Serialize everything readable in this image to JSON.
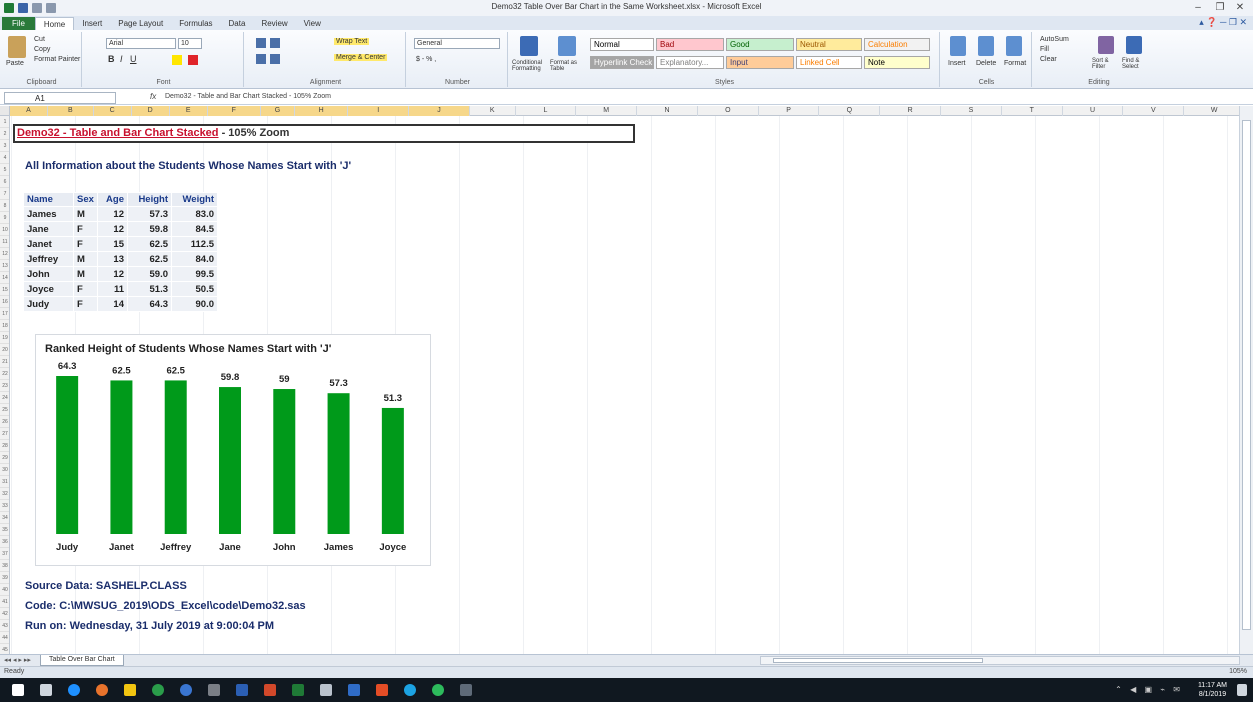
{
  "window": {
    "title": "Demo32 Table Over Bar Chart in the Same Worksheet.xlsx - Microsoft Excel",
    "minimize": "–",
    "restore": "❐",
    "close": "✕",
    "help_icons": "▴ ❓ ─ ❐ ✕"
  },
  "ribbon": {
    "tabs": [
      {
        "label": "File"
      },
      {
        "label": "Home"
      },
      {
        "label": "Insert"
      },
      {
        "label": "Page Layout"
      },
      {
        "label": "Formulas"
      },
      {
        "label": "Data"
      },
      {
        "label": "Review"
      },
      {
        "label": "View"
      }
    ],
    "clipboard": {
      "cut": "Cut",
      "copy": "Copy",
      "paste": "Paste",
      "format_painter": "Format Painter",
      "group_label": "Clipboard"
    },
    "font": {
      "font_name": "Arial",
      "font_size": "10",
      "group_label": "Font"
    },
    "alignment": {
      "wrap_text": "Wrap Text",
      "merge_center": "Merge & Center",
      "group_label": "Alignment"
    },
    "number": {
      "format": "General",
      "group_label": "Number"
    },
    "styles": {
      "conditional_formatting": "Conditional Formatting",
      "format_as_table": "Format as Table",
      "cell_styles": [
        {
          "label": "Normal",
          "bg": "#ffffff",
          "color": "#000000"
        },
        {
          "label": "Bad",
          "bg": "#ffc7ce",
          "color": "#9c0006"
        },
        {
          "label": "Good",
          "bg": "#c6efce",
          "color": "#006100"
        },
        {
          "label": "Neutral",
          "bg": "#ffeb9c",
          "color": "#9c5700"
        },
        {
          "label": "Calculation",
          "bg": "#f2f2f2",
          "color": "#fa7d00"
        },
        {
          "label": "Hyperlink Check Cell",
          "bg": "#a5a5a5",
          "color": "#ffffff"
        },
        {
          "label": "Explanatory...",
          "bg": "#ffffff",
          "color": "#7f7f7f"
        },
        {
          "label": "Input",
          "bg": "#ffcc99",
          "color": "#3f3f76"
        },
        {
          "label": "Linked Cell",
          "bg": "#ffffff",
          "color": "#fa7d00"
        },
        {
          "label": "Note",
          "bg": "#ffffcc",
          "color": "#000000"
        }
      ],
      "group_label": "Styles"
    },
    "cells": {
      "insert": "Insert",
      "delete": "Delete",
      "format": "Format",
      "group_label": "Cells"
    },
    "editing": {
      "autosum": "AutoSum",
      "fill": "Fill",
      "clear": "Clear",
      "sort_filter": "Sort & Filter",
      "find_select": "Find & Select",
      "group_label": "Editing"
    }
  },
  "formula_bar": {
    "name_box": "A1",
    "fx": "fx",
    "content": "Demo32 - Table and Bar Chart Stacked - 105% Zoom"
  },
  "columns": [
    "A",
    "B",
    "C",
    "D",
    "E",
    "F",
    "G",
    "H",
    "I",
    "J",
    "K",
    "L",
    "M",
    "N",
    "O",
    "P",
    "Q",
    "R",
    "S",
    "T",
    "U",
    "V",
    "W"
  ],
  "sheet": {
    "title_red": "Demo32 - Table and Bar Chart Stacked",
    "title_black": " - 105% Zoom",
    "subtitle": "All Information about the Students Whose Names Start with 'J'",
    "table": {
      "headers": [
        "Name",
        "Sex",
        "Age",
        "Height",
        "Weight"
      ],
      "rows": [
        [
          "James",
          "M",
          "12",
          "57.3",
          "83.0"
        ],
        [
          "Jane",
          "F",
          "12",
          "59.8",
          "84.5"
        ],
        [
          "Janet",
          "F",
          "15",
          "62.5",
          "112.5"
        ],
        [
          "Jeffrey",
          "M",
          "13",
          "62.5",
          "84.0"
        ],
        [
          "John",
          "M",
          "12",
          "59.0",
          "99.5"
        ],
        [
          "Joyce",
          "F",
          "11",
          "51.3",
          "50.5"
        ],
        [
          "Judy",
          "F",
          "14",
          "64.3",
          "90.0"
        ]
      ]
    },
    "footer": {
      "source": "Source Data: SASHELP.CLASS",
      "code": "Code: C:\\MWSUG_2019\\ODS_Excel\\code\\Demo32.sas",
      "run_on": "Run on: Wednesday, 31 July 2019 at 9:00:04 PM"
    }
  },
  "chart_data": {
    "type": "bar",
    "title": "Ranked Height of Students Whose Names Start with 'J'",
    "categories": [
      "Judy",
      "Janet",
      "Jeffrey",
      "Jane",
      "John",
      "James",
      "Joyce"
    ],
    "values": [
      64.3,
      62.5,
      62.5,
      59.8,
      59,
      57.3,
      51.3
    ],
    "value_labels": [
      "64.3",
      "62.5",
      "62.5",
      "59.8",
      "59",
      "57.3",
      "51.3"
    ],
    "xlabel": "",
    "ylabel": "",
    "ylim": [
      0,
      70
    ],
    "grid": false,
    "bar_color": "#009a1a"
  },
  "status": {
    "sheet_tab": "Table Over Bar Chart",
    "ready": "Ready",
    "zoom": "105%"
  },
  "taskbar": {
    "time": "11:17 AM",
    "date": "8/1/2019"
  }
}
